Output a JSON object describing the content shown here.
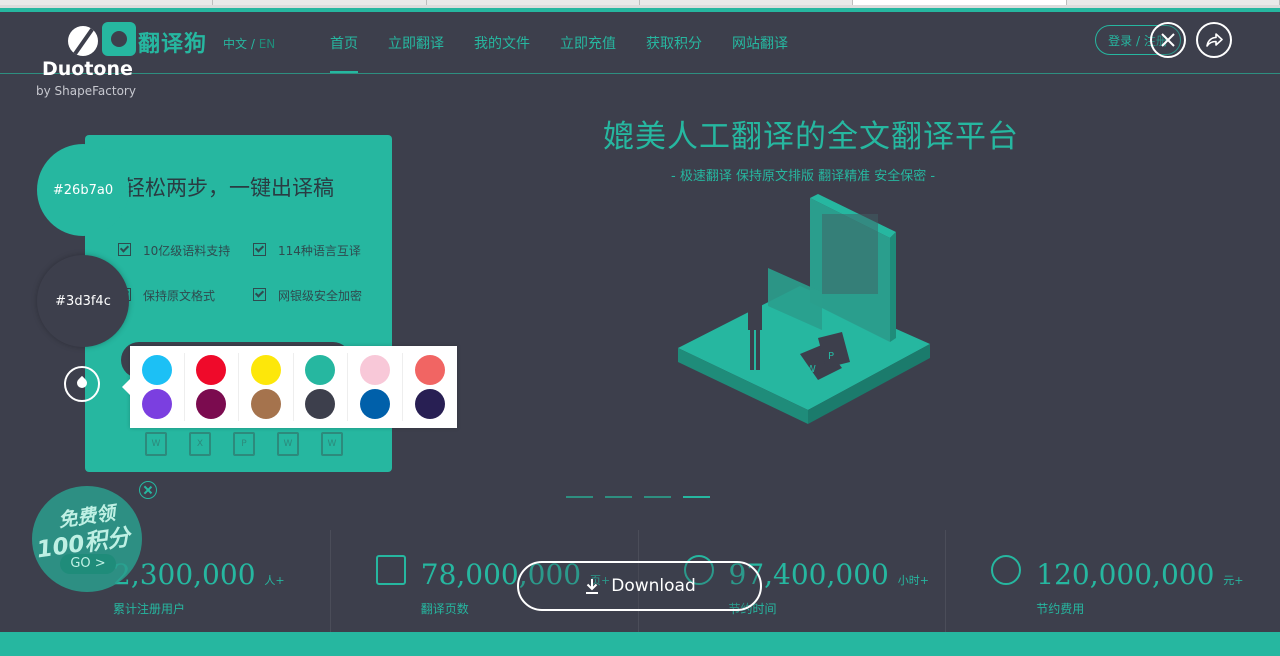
{
  "site": {
    "brand": "翻译狗",
    "lang_zh": "中文",
    "lang_sep": " / ",
    "lang_en": "EN",
    "nav": [
      "首页",
      "立即翻译",
      "我的文件",
      "立即充值",
      "获取积分",
      "网站翻译"
    ],
    "login": "登录 / 注册",
    "card": {
      "title": "轻松两步，一键出译稿",
      "features": [
        "10亿级语料支持",
        "114种语言互译",
        "保持原文格式",
        "网银级安全加密"
      ],
      "file_icons": [
        "W",
        "X",
        "P",
        "W",
        "W"
      ]
    },
    "hero": {
      "title": "媲美人工翻译的全文翻译平台",
      "subtitle": "- 极速翻译 保持原文排版 翻译精准 安全保密 -"
    },
    "carousel_active": 4,
    "stats": [
      {
        "number": "2,300,000",
        "unit": "人+",
        "label": "累计注册用户"
      },
      {
        "number": "78,000,000",
        "unit": "页+",
        "label": "翻译页数"
      },
      {
        "number": "97,400,000",
        "unit": "小时+",
        "label": "节约时间"
      },
      {
        "number": "120,000,000",
        "unit": "元+",
        "label": "节约费用"
      }
    ],
    "promo": {
      "line1": "免费领",
      "line2": "100积分",
      "go": "GO >"
    }
  },
  "duotone": {
    "name": "Duotone",
    "by": "by ShapeFactory",
    "color1": "#26b7a0",
    "color2": "#3d3f4c",
    "palette": [
      "#1cc0f5",
      "#ef0a2a",
      "#fde70a",
      "#26b7a0",
      "#f8c8d8",
      "#f16563",
      "#7b3fe0",
      "#7b0b4f",
      "#a5734d",
      "#3d3f4c",
      "#0060aa",
      "#281f53"
    ],
    "download": "Download"
  },
  "colors": {
    "accent": "#26b7a0",
    "background": "#3d3f4c"
  }
}
